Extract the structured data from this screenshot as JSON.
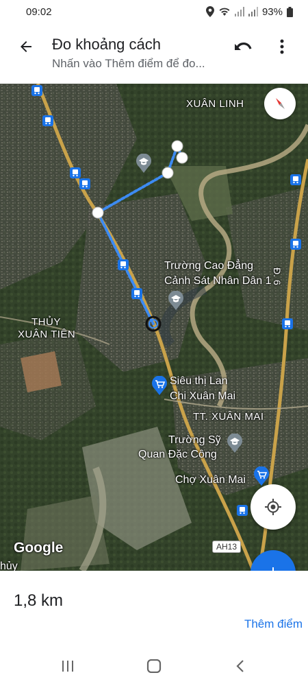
{
  "status_bar": {
    "time": "09:02",
    "battery": "93%",
    "icons": [
      "location-icon",
      "wifi-icon",
      "signal-icon",
      "signal-icon",
      "battery-icon"
    ]
  },
  "app_bar": {
    "title": "Đo khoảng cách",
    "subtitle": "Nhấn vào Thêm điểm để đo...",
    "back_icon": "arrow-back-icon",
    "undo_icon": "undo-icon",
    "more_icon": "more-vert-icon"
  },
  "map": {
    "labels": {
      "xuan_linh": "XUÂN LINH",
      "college_line1": "Trường Cao Đẳng",
      "college_line2": "Cảnh Sát Nhân Dân 1",
      "thuy_line1": "THỦY",
      "thuy_line2": "XUÂN TIÊN",
      "supermarket_line1": "Siêu thị Lan",
      "supermarket_line2": "Chi Xuân Mai",
      "tt_xuan_mai": "TT. XUÂN MAI",
      "officer_line1": "Trường Sỹ",
      "officer_line2": "Quan Đặc Công",
      "market": "Chợ Xuân Mai",
      "road_d6": "Đ. 6",
      "bottom_partial": "hủy",
      "road_shield": "AH13"
    },
    "google_logo": "Google",
    "route_color": "#3d8bf2",
    "accent": "#1a73e8"
  },
  "bottom_panel": {
    "distance": "1,8 km",
    "add_point": "Thêm điểm"
  },
  "nav_bar": {
    "icons": [
      "recent-apps-icon",
      "home-icon",
      "back-nav-icon"
    ]
  }
}
